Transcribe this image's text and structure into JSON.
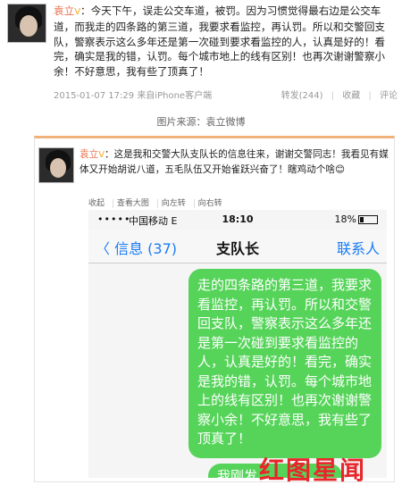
{
  "post1": {
    "username": "袁立",
    "badge": "V",
    "body": "：今天下午，误走公交车道，被罚。因为习惯觉得最右边是公交车道，而我走的四条路的第三道，我要求看监控，再认罚。所以和交警回支队，警察表示这么多年还是第一次碰到要求看监控的人，认真是好的！看完，确实是我的错，认罚。每个城市地上的线有区别！也再次谢谢警察小余！不好意思，我有些了顶真了！",
    "timestamp": "2015-01-07 17:29",
    "client": "来自iPhone客户端",
    "repost": "转发(244)",
    "favorite": "收藏",
    "comment": "评论"
  },
  "source_caption": "图片来源：袁立微博",
  "post2": {
    "username": "袁立",
    "badge": "V",
    "body": "：这是我和交警大队支队长的信息往来，谢谢交警同志！我看见有媒体又开始胡说八道，五毛队伍又开始雀跃兴奋了！瞎鸡动个啥",
    "emoji": "😊",
    "actions": [
      "收起",
      "查看大图",
      "向左转",
      "向右转"
    ]
  },
  "phone": {
    "signal": "•••••",
    "carrier": "中国移动",
    "network": "E",
    "time": "18:10",
    "battery": "18%",
    "back_label": "〈 信息 (37)",
    "title": "支队长",
    "contact": "联系人",
    "message": "走的四条路的第三道，我要求看监控，再认罚。所以和交警回支队，警察表示这么多年还是第一次碰到要求看监控的人，认真是好的！看完，确实是我的错，认罚。每个城市地上的线有区别！也再次谢谢警察小余！不好意思，我有些了顶真了！",
    "message2": "我刚发"
  },
  "watermark": "红图星闻",
  "colors": {
    "username": "#eb7350",
    "bubble": "#56d45a",
    "ios_blue": "#1a7cf5",
    "watermark": "#e8262b"
  }
}
